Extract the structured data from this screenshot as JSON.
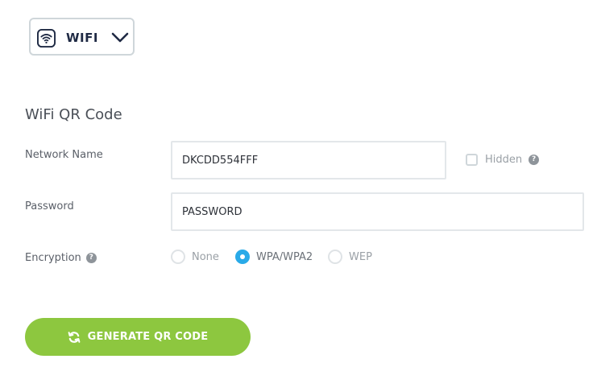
{
  "type_selector": {
    "label": "WIFI",
    "icon": "wifi-icon"
  },
  "section": {
    "title": "WiFi QR Code"
  },
  "network_name": {
    "label": "Network Name",
    "value": "DKCDD554FFF"
  },
  "hidden": {
    "label": "Hidden",
    "checked": false,
    "help": "?"
  },
  "password": {
    "label": "Password",
    "value": "PASSWORD"
  },
  "encryption": {
    "label": "Encryption",
    "help": "?",
    "options": [
      {
        "label": "None",
        "selected": false
      },
      {
        "label": "WPA/WPA2",
        "selected": true
      },
      {
        "label": "WEP",
        "selected": false
      }
    ]
  },
  "generate_button": {
    "label": "GENERATE QR CODE",
    "icon": "refresh-icon"
  },
  "colors": {
    "accent_green": "#8dc73f",
    "radio_selected": "#29aae8",
    "border": "#cfd6da"
  }
}
